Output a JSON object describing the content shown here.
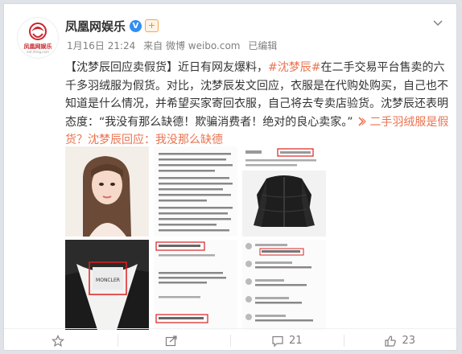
{
  "post": {
    "author": "凤凰网娱乐",
    "verified_badge": "V",
    "follow_icon": "+",
    "avatar_logo_text": "凤凰网娱乐",
    "avatar_logo_sub": "ent.ifeng.com",
    "time": "1月16日 21:24",
    "source": "来自 微博 weibo.com",
    "edited": "已编辑",
    "body_pre_hashtag": "【沈梦辰回应卖假货】近日有网友爆料，",
    "hashtag": "#沈梦辰#",
    "body_post_hashtag": "在二手交易平台售卖的六千多羽绒服为假货。对比，沈梦辰发文回应，衣服是在代购处购买，自己也不知道是什么情况，并希望买家寄回衣服，自己将去专卖店验货。沈梦辰还表明态度：“我没有那么缺德！欺骗消费者！绝对的良心卖家。”",
    "link_text": "二手羽绒服是假货？沈梦辰回应：我没那么缺德"
  },
  "images": {
    "screenshot_text_1": "没有人在乎第一个",
    "screenshot_text_2": "各种味儿 无好看啊 假货",
    "screenshot_text_3": "这些年不是买的，没钱频繁了",
    "brand_label": "MONCLER"
  },
  "actions": {
    "forward_count": "",
    "comment_count": "21",
    "like_count": "23"
  },
  "icons": {
    "more": "chevron-down-icon",
    "forward": "forward-icon",
    "comment": "comment-icon",
    "like": "like-icon"
  },
  "colors": {
    "link": "#eb7350",
    "badge": "#2f8ef6",
    "brand": "#c8262c"
  }
}
